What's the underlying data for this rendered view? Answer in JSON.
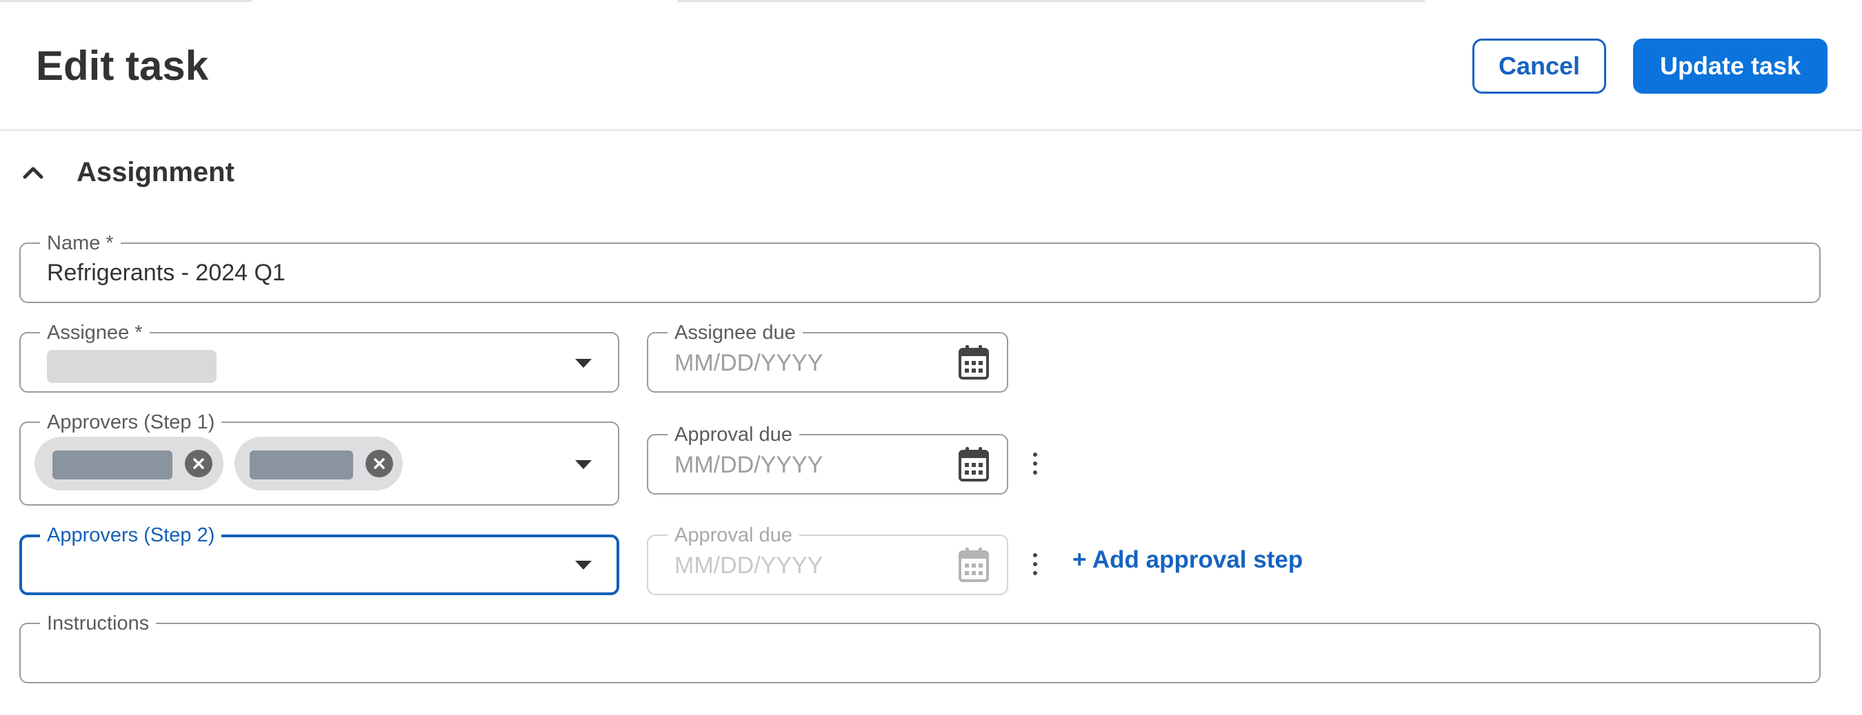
{
  "header": {
    "title": "Edit task",
    "cancel_label": "Cancel",
    "update_label": "Update task"
  },
  "section": {
    "title": "Assignment",
    "expanded": true
  },
  "form": {
    "name": {
      "label": "Name *",
      "value": "Refrigerants - 2024 Q1"
    },
    "assignee": {
      "label": "Assignee *",
      "value_redacted": true
    },
    "assignee_due": {
      "label": "Assignee due",
      "placeholder": "MM/DD/YYYY"
    },
    "approvers_step1": {
      "label": "Approvers (Step 1)",
      "chips": [
        "redacted",
        "redacted"
      ]
    },
    "approval_due_1": {
      "label": "Approval due",
      "placeholder": "MM/DD/YYYY"
    },
    "approvers_step2": {
      "label": "Approvers (Step 2)",
      "focused": true
    },
    "approval_due_2": {
      "label": "Approval due",
      "placeholder": "MM/DD/YYYY",
      "disabled": true
    },
    "add_step_label": "+ Add approval step",
    "instructions": {
      "label": "Instructions",
      "value": ""
    }
  },
  "icons": {
    "collapse": "chevron-up-icon",
    "dropdown": "caret-down-icon",
    "calendar": "calendar-icon",
    "remove_chip": "close-circle-icon",
    "more": "kebab-menu-icon"
  },
  "colors": {
    "primary": "#0c73dc",
    "link": "#1563c0",
    "focus": "#1460b9",
    "text": "#333333"
  }
}
